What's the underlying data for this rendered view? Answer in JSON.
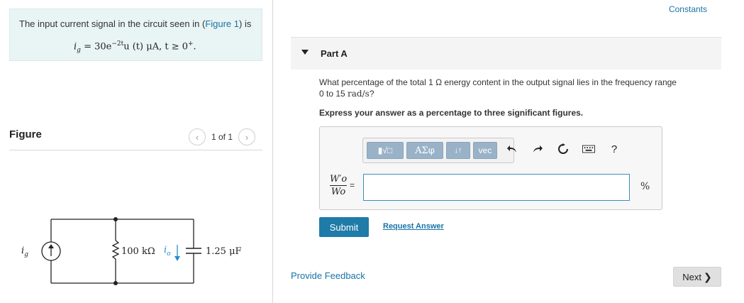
{
  "problem": {
    "text_before": "The input current signal in the circuit seen in (",
    "link": "Figure 1",
    "text_after": ") is",
    "equation": {
      "lhs": "i",
      "lhs_sub": "g",
      "mid": " = 30e",
      "exp": "−2t",
      "rest": "u (t)  μA,   t ≥ 0",
      "rest_sup": "+",
      "end": "."
    }
  },
  "figure": {
    "label": "Figure",
    "pager": "1 of 1",
    "prev": "‹",
    "next": "›",
    "circuit": {
      "source_label": "i",
      "source_sub": "g",
      "resistor": "100 kΩ",
      "current_label": "i",
      "current_sub": "o",
      "capacitor": "1.25 μF"
    }
  },
  "right": {
    "constants": "Constants",
    "part_title": "Part A",
    "question_line1": "What percentage of the total 1 Ω energy content in the output signal lies in the frequency range",
    "question_line2_pre": "0 to 15 ",
    "question_line2_unit": "rad/s",
    "question_line2_end": "?",
    "instruction": "Express your answer as a percentage to three significant figures.",
    "toolbar": {
      "templates": "▮√□",
      "greek": "ΑΣφ",
      "arrows": "↓↑",
      "vec": "vec",
      "help": "?"
    },
    "fraction": {
      "num": "W′o",
      "den": "Wo"
    },
    "equals": "=",
    "answer_value": "",
    "unit": "%",
    "submit": "Submit",
    "request_answer": "Request Answer",
    "feedback": "Provide Feedback",
    "next": "Next",
    "next_chev": "❯"
  }
}
